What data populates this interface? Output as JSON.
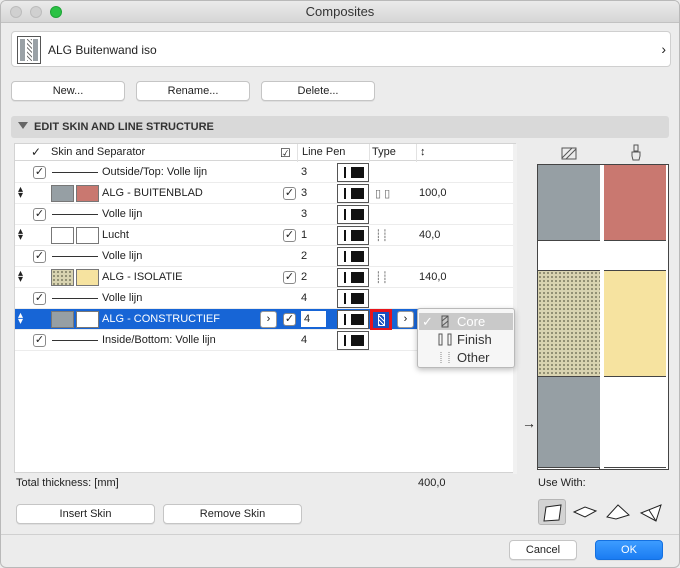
{
  "window": {
    "title": "Composites"
  },
  "selector": {
    "label": "ALG Buitenwand iso"
  },
  "toolbar": {
    "new_label": "New...",
    "rename_label": "Rename...",
    "delete_label": "Delete..."
  },
  "section": {
    "title": "EDIT SKIN AND LINE STRUCTURE"
  },
  "table": {
    "headers": {
      "skin": "Skin and Separator",
      "line_pen": "Line Pen",
      "type": "Type"
    },
    "rows": [
      {
        "kind": "line",
        "label": "Outside/Top: Volle lijn",
        "checked": true,
        "pen": "3"
      },
      {
        "kind": "skin",
        "label": "ALG - BUITENBLAD",
        "pen": "3",
        "checked": true,
        "thickness": "100,0",
        "type": "finish",
        "swatch_left": "#969fa4",
        "swatch_right": "#c97870"
      },
      {
        "kind": "line",
        "label": "Volle lijn",
        "checked": true,
        "pen": "3"
      },
      {
        "kind": "skin",
        "label": "Lucht",
        "pen": "1",
        "checked": true,
        "thickness": "40,0",
        "type": "other",
        "swatch_left": "#ffffff",
        "swatch_right": "#ffffff"
      },
      {
        "kind": "line",
        "label": "Volle lijn",
        "checked": true,
        "pen": "2"
      },
      {
        "kind": "skin",
        "label": "ALG - ISOLATIE",
        "pen": "2",
        "checked": true,
        "thickness": "140,0",
        "type": "other",
        "swatch_left": "hatch",
        "swatch_right": "#f6e3a0"
      },
      {
        "kind": "line",
        "label": "Volle lijn",
        "checked": true,
        "pen": "4"
      },
      {
        "kind": "skin",
        "label": "ALG - CONSTRUCTIEF",
        "pen": "4",
        "checked": true,
        "thickness": "",
        "type": "core",
        "selected": true,
        "swatch_left": "#969fa4",
        "swatch_right": "#ffffff"
      },
      {
        "kind": "line",
        "label": "Inside/Bottom: Volle lijn",
        "checked": true,
        "pen": "4"
      }
    ]
  },
  "type_menu": {
    "options": [
      {
        "label": "Core",
        "selected": true
      },
      {
        "label": "Finish",
        "selected": false
      },
      {
        "label": "Other",
        "selected": false
      }
    ]
  },
  "total": {
    "label": "Total thickness: [mm]",
    "value": "400,0"
  },
  "skin_buttons": {
    "insert_label": "Insert Skin",
    "remove_label": "Remove Skin"
  },
  "use_with": {
    "label": "Use With:"
  },
  "dialog_buttons": {
    "cancel_label": "Cancel",
    "ok_label": "OK"
  },
  "preview": {
    "cut_fill_colors": [
      "#969fa4",
      "#ffffff",
      "hatch",
      "#969fa4"
    ],
    "surface_colors": [
      "#c97870",
      "#ffffff",
      "#f6e3a0",
      "#ffffff"
    ],
    "thickness_mm": [
      100,
      40,
      140,
      120
    ]
  },
  "colors": {
    "selection": "#1765d6",
    "accent": "#1a7cf2",
    "highlight_border": "#e8141c"
  }
}
